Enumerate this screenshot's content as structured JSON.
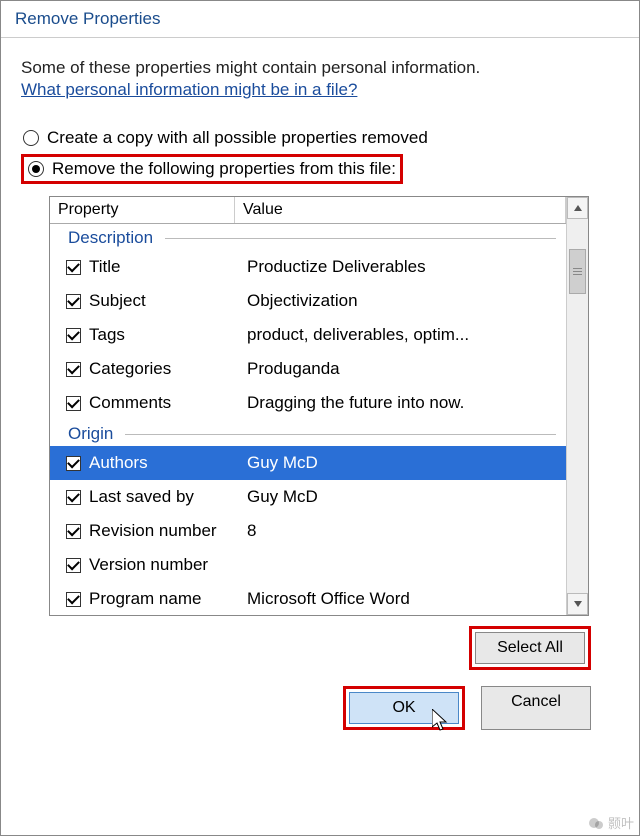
{
  "title": "Remove Properties",
  "intro": "Some of these properties might contain personal information.",
  "help_link": "What personal information might be in a file?",
  "radio1": "Create a copy with all possible properties removed",
  "radio2": "Remove the following properties from this file:",
  "columns": {
    "property": "Property",
    "value": "Value"
  },
  "groups": {
    "description": "Description",
    "origin": "Origin"
  },
  "rows": {
    "title": {
      "label": "Title",
      "value": "Productize Deliverables"
    },
    "subject": {
      "label": "Subject",
      "value": "Objectivization"
    },
    "tags": {
      "label": "Tags",
      "value": "product, deliverables, optim..."
    },
    "categories": {
      "label": "Categories",
      "value": "Produganda"
    },
    "comments": {
      "label": "Comments",
      "value": "Dragging the future into now."
    },
    "authors": {
      "label": "Authors",
      "value": "Guy McD"
    },
    "lastsaved": {
      "label": "Last saved by",
      "value": "Guy McD"
    },
    "revision": {
      "label": "Revision number",
      "value": "8"
    },
    "version": {
      "label": "Version number",
      "value": ""
    },
    "program": {
      "label": "Program name",
      "value": "Microsoft Office Word"
    }
  },
  "buttons": {
    "select_all": "Select All",
    "ok": "OK",
    "cancel": "Cancel"
  },
  "watermark": "颢叶"
}
